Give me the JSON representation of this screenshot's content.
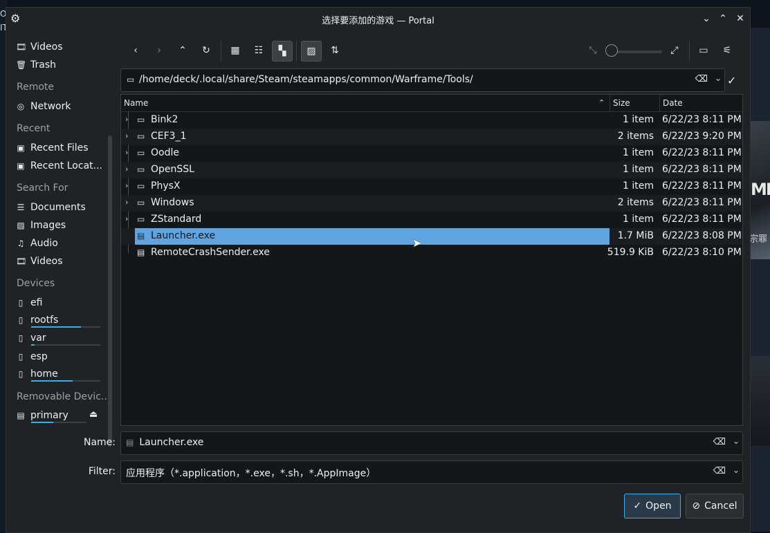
{
  "window": {
    "title": "选择要添加的游戏 — Portal"
  },
  "background": {
    "left_text": "OI\nIT",
    "right_logo_text": "ME",
    "right_cn_text": "宗罪"
  },
  "sidebar": {
    "items_top": [
      {
        "icon": "video-icon",
        "label": "Videos"
      },
      {
        "icon": "trash-icon",
        "label": "Trash"
      }
    ],
    "remote_heading": "Remote",
    "remote_items": [
      {
        "icon": "network-icon",
        "label": "Network"
      }
    ],
    "recent_heading": "Recent",
    "recent_items": [
      {
        "icon": "recent-files-icon",
        "label": "Recent Files"
      },
      {
        "icon": "recent-locations-icon",
        "label": "Recent Locat..."
      }
    ],
    "search_heading": "Search For",
    "search_items": [
      {
        "icon": "documents-icon",
        "label": "Documents"
      },
      {
        "icon": "images-icon",
        "label": "Images"
      },
      {
        "icon": "audio-icon",
        "label": "Audio"
      },
      {
        "icon": "video-icon",
        "label": "Videos"
      }
    ],
    "devices_heading": "Devices",
    "devices": [
      {
        "icon": "drive-icon",
        "label": "efi",
        "usage": null
      },
      {
        "icon": "drive-icon",
        "label": "rootfs",
        "usage": 0.72
      },
      {
        "icon": "drive-icon",
        "label": "var",
        "usage": 0.05
      },
      {
        "icon": "drive-icon",
        "label": "esp",
        "usage": null
      },
      {
        "icon": "drive-icon",
        "label": "home",
        "usage": 0.6
      }
    ],
    "removable_heading": "Removable Devic...",
    "removable": [
      {
        "icon": "sd-card-icon",
        "label": "primary",
        "usage": 0.4
      }
    ]
  },
  "location": {
    "path": "/home/deck/.local/share/Steam/steamapps/common/Warframe/Tools/"
  },
  "columns": {
    "name": "Name",
    "size": "Size",
    "date": "Date"
  },
  "files": [
    {
      "name": "Bink2",
      "size": "1 item",
      "date": "6/22/23 8:11 PM",
      "type": "folder"
    },
    {
      "name": "CEF3_1",
      "size": "2 items",
      "date": "6/22/23 9:20 PM",
      "type": "folder"
    },
    {
      "name": "Oodle",
      "size": "1 item",
      "date": "6/22/23 8:11 PM",
      "type": "folder"
    },
    {
      "name": "OpenSSL",
      "size": "1 item",
      "date": "6/22/23 8:11 PM",
      "type": "folder"
    },
    {
      "name": "PhysX",
      "size": "1 item",
      "date": "6/22/23 8:11 PM",
      "type": "folder"
    },
    {
      "name": "Windows",
      "size": "2 items",
      "date": "6/22/23 8:11 PM",
      "type": "folder"
    },
    {
      "name": "ZStandard",
      "size": "1 item",
      "date": "6/22/23 8:11 PM",
      "type": "folder"
    },
    {
      "name": "Launcher.exe",
      "size": "1.7 MiB",
      "date": "6/22/23 8:08 PM",
      "type": "exe",
      "selected": true
    },
    {
      "name": "RemoteCrashSender.exe",
      "size": "519.9 KiB",
      "date": "6/22/23 8:10 PM",
      "type": "exe"
    }
  ],
  "name_field": {
    "label": "Name:",
    "value": "Launcher.exe"
  },
  "filter_field": {
    "label": "Filter:",
    "value": "应用程序（*.application，*.exe，*.sh，*.AppImage）"
  },
  "buttons": {
    "open": "Open",
    "cancel": "Cancel"
  },
  "colors": {
    "accent": "#3daee9",
    "selection": "#5fa3e0"
  }
}
